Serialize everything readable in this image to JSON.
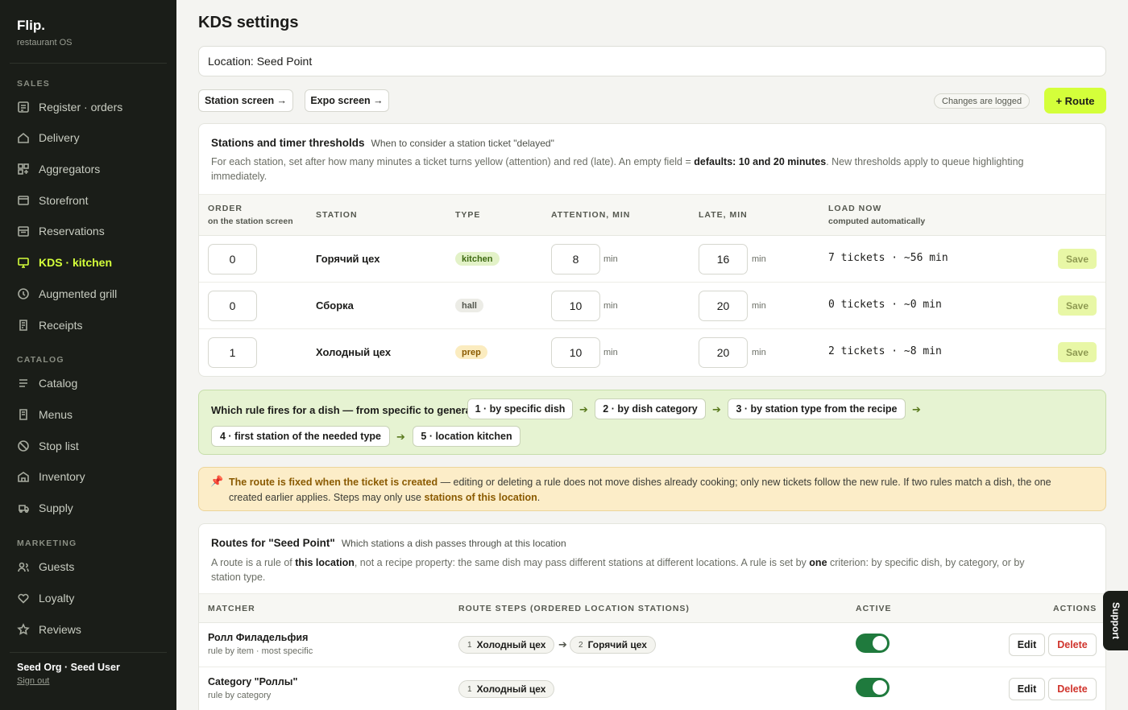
{
  "sidebar": {
    "brand": "Flip.",
    "brand_sub": "restaurant OS",
    "sections": {
      "sales": "SALES",
      "catalog": "CATALOG",
      "marketing": "MARKETING"
    },
    "items": [
      {
        "label": "Register · orders",
        "icon": "register-icon"
      },
      {
        "label": "Delivery",
        "icon": "delivery-icon"
      },
      {
        "label": "Aggregators",
        "icon": "grid-icon"
      },
      {
        "label": "Storefront",
        "icon": "storefront-icon"
      },
      {
        "label": "Reservations",
        "icon": "calendar-icon"
      },
      {
        "label": "KDS · kitchen",
        "icon": "monitor-icon",
        "active": true
      },
      {
        "label": "Augmented grill",
        "icon": "clock-icon"
      },
      {
        "label": "Receipts",
        "icon": "receipt-icon"
      },
      {
        "label": "Catalog",
        "icon": "list-icon"
      },
      {
        "label": "Menus",
        "icon": "menu-book-icon"
      },
      {
        "label": "Stop list",
        "icon": "stop-icon"
      },
      {
        "label": "Inventory",
        "icon": "warehouse-icon"
      },
      {
        "label": "Supply",
        "icon": "truck-icon"
      },
      {
        "label": "Guests",
        "icon": "users-icon"
      },
      {
        "label": "Loyalty",
        "icon": "heart-icon"
      },
      {
        "label": "Reviews",
        "icon": "star-icon"
      }
    ],
    "org": "Seed Org · Seed User",
    "sign_out": "Sign out"
  },
  "header": {
    "title": "KDS settings",
    "location_value": "Location: Seed Point",
    "station_screen": "Station screen →",
    "expo_screen": "Expo screen →",
    "changes_logged": "Changes are logged",
    "add_route": "+ Route"
  },
  "thresholds": {
    "title": "Stations and timer thresholds",
    "subtitle": "When to consider a station ticket \"delayed\"",
    "desc_pre": "For each station, set after how many minutes a ticket turns yellow (attention) and red (late). An empty field = ",
    "desc_bold": "defaults: 10 and 20 minutes",
    "desc_post": ". New thresholds apply to queue highlighting immediately.",
    "columns": {
      "order": "ORDER",
      "order_sub": "on the station screen",
      "station": "STATION",
      "type": "TYPE",
      "attention": "ATTENTION, MIN",
      "late": "LATE, MIN",
      "load": "LOAD NOW",
      "load_sub": "computed automatically"
    },
    "unit": "min",
    "save": "Save",
    "rows": [
      {
        "order": "0",
        "station": "Горячий цех",
        "type": "kitchen",
        "attention": "8",
        "late": "16",
        "load": "7 tickets · ~56 min"
      },
      {
        "order": "0",
        "station": "Сборка",
        "type": "hall",
        "attention": "10",
        "late": "20",
        "load": "0 tickets · ~0 min"
      },
      {
        "order": "1",
        "station": "Холодный цех",
        "type": "prep",
        "attention": "10",
        "late": "20",
        "load": "2 tickets · ~8 min"
      }
    ],
    "type_colors": {
      "kitchen": {
        "bg": "#e3f2c8",
        "fg": "#3e6a12"
      },
      "hall": {
        "bg": "#ececE6",
        "fg": "#55584f"
      },
      "prep": {
        "bg": "#fbecc0",
        "fg": "#8a5a00"
      }
    }
  },
  "rules": {
    "label": "Which rule fires for a dish — from specific to general:",
    "chips": [
      "1 · by specific dish",
      "2 · by dish category",
      "3 · by station type from the recipe",
      "4 · first station of the needed type",
      "5 · location kitchen"
    ],
    "arrow": "➔"
  },
  "warning": {
    "icon": "pin-icon",
    "bold": "The route is fixed when the ticket is created",
    "text": " — editing or deleting a rule does not move dishes already cooking; only new tickets follow the new rule. If two rules match a dish, the one created earlier applies. Steps may only use ",
    "link": "stations of this location",
    "end": "."
  },
  "routes": {
    "title": "Routes for \"Seed Point\"",
    "subtitle": "Which stations a dish passes through at this location",
    "desc_1": "A route is a rule of ",
    "desc_b1": "this location",
    "desc_2": ", not a recipe property: the same dish may pass different stations at different locations. A rule is set by ",
    "desc_b2": "one",
    "desc_3": " criterion: by specific dish, by category, or by station type.",
    "columns": {
      "matcher": "MATCHER",
      "steps": "ROUTE STEPS (ORDERED LOCATION STATIONS)",
      "active": "ACTIVE",
      "actions": "ACTIONS"
    },
    "edit": "Edit",
    "delete": "Delete",
    "rows": [
      {
        "name": "Ролл Филадельфия",
        "sub": "rule by item · most specific",
        "steps": [
          {
            "n": "1",
            "label": "Холодный цех"
          },
          {
            "n": "2",
            "label": "Горячий цех"
          }
        ],
        "active": true
      },
      {
        "name": "Category \"Роллы\"",
        "sub": "rule by category",
        "steps": [
          {
            "n": "1",
            "label": "Холодный цех"
          }
        ],
        "active": true
      }
    ]
  },
  "support": "Support"
}
